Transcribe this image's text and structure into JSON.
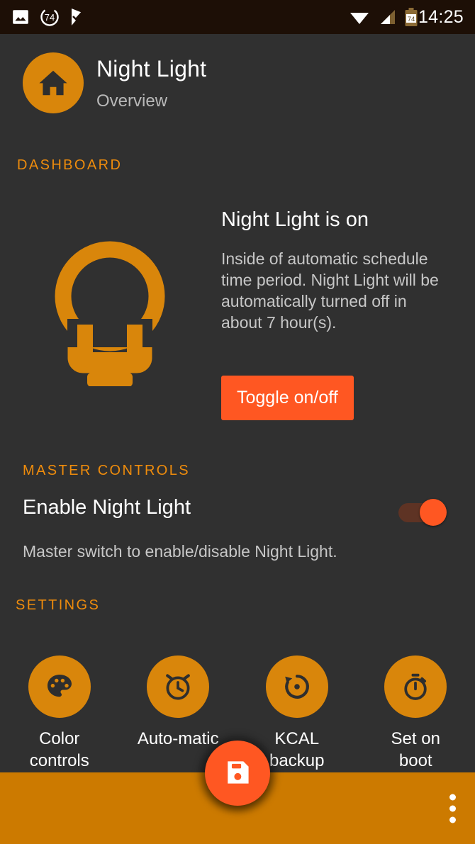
{
  "status_bar": {
    "time": "14:25",
    "battery_percent": "74",
    "left_icons": [
      "image-icon",
      "progress-74-icon",
      "check-flag-icon"
    ],
    "right_icons": [
      "wifi-icon",
      "cell-signal-icon",
      "battery-icon"
    ],
    "background_color": "#1d0f06"
  },
  "header": {
    "icon": "home-icon",
    "title": "Night Light",
    "subtitle": "Overview",
    "accent_color": "#d9860b"
  },
  "sections": {
    "dashboard_label": "DASHBOARD",
    "master_label": "MASTER CONTROLS",
    "settings_label": "SETTINGS",
    "label_color": "#ef8c0c"
  },
  "dashboard": {
    "icon": "lightbulb-icon",
    "status_title": "Night Light is on",
    "status_description": "Inside of automatic schedule time period. Night Light will be automatically turned off in about 7 hour(s).",
    "hours_remaining": "7",
    "toggle_button_label": "Toggle on/off",
    "toggle_button_color": "#ff5722"
  },
  "master_controls": {
    "title": "Enable Night Light",
    "description": "Master switch to enable/disable Night Light.",
    "switch_state": "on",
    "switch_thumb_color": "#ff5722",
    "switch_track_color": "#5e3324"
  },
  "settings": {
    "items": [
      {
        "label": "Color controls",
        "icon": "palette-icon"
      },
      {
        "label": "Auto-matic",
        "icon": "alarm-clock-icon"
      },
      {
        "label": "KCAL backup",
        "icon": "restore-backup-icon"
      },
      {
        "label": "Set on boot",
        "icon": "timer-icon"
      }
    ]
  },
  "fab": {
    "icon": "save-floppy-icon",
    "color": "#ff5722"
  },
  "bottom_bar": {
    "overflow_icon": "more-vertical-icon",
    "background_color": "#cc7a00"
  }
}
